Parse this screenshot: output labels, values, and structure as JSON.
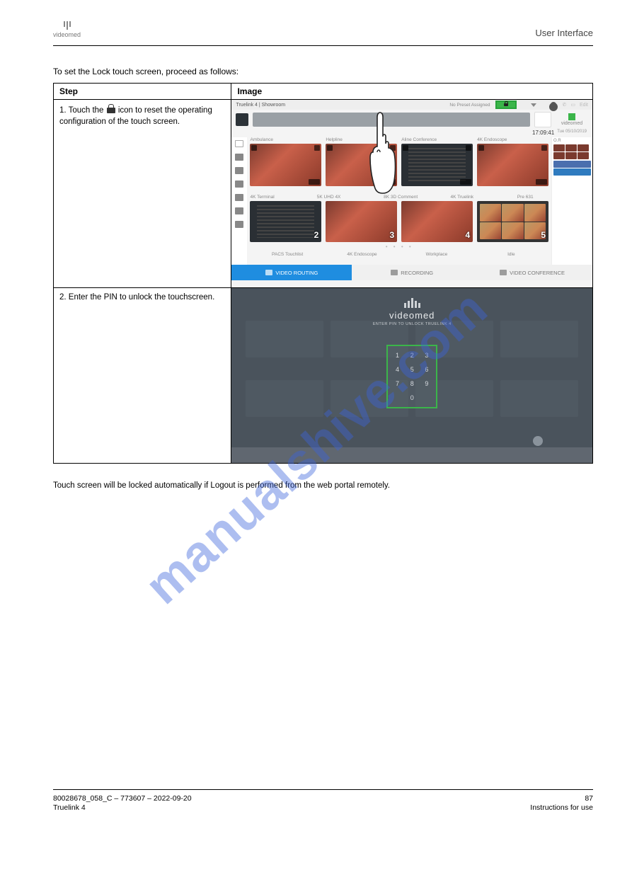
{
  "header": {
    "brand": "videomed",
    "section_title": "User Interface"
  },
  "intro": "To set the Lock touch screen, proceed as follows:",
  "table": {
    "col1": "Step",
    "col2": "Image",
    "step1_a": "1.  Touch the ",
    "step1_b": " icon to reset the operating configuration of the touch screen.",
    "step2": "2.  Enter the PIN to unlock the touchscreen."
  },
  "hint": "Touch screen will be locked automatically if Logout is performed from the web portal remotely.",
  "shot1": {
    "topbar": {
      "title": "Truelink 4 | Showroom",
      "no_preset": "No Preset Assigned",
      "right_text": "Edit"
    },
    "brand": "videomed",
    "time": "17:09:41",
    "date": "Tue 05/10/2019",
    "row1_labels": [
      "Ambulance",
      "Helpline",
      "Aline Conference",
      "4K Endoscope"
    ],
    "row2_labels": [
      "4K Terminal",
      "5K UHD 4X",
      "8K 3D Comment",
      "4K Truelink",
      "Pre 631"
    ],
    "row2_nums": [
      "2",
      "3",
      "4",
      "5"
    ],
    "sidepanel_hdr": "O.R",
    "dots": "• • • •",
    "presets": [
      "PACS Touchlist",
      "4K Endoscope",
      "Workplace",
      "Idle"
    ],
    "tabs": {
      "routing": "VIDEO ROUTING",
      "recording": "RECORDING",
      "conference": "VIDEO CONFERENCE"
    }
  },
  "shot2": {
    "brand": "videomed",
    "subtitle": "ENTER PIN TO UNLOCK TRUELINK 4",
    "keys": [
      [
        "1",
        "2",
        "3"
      ],
      [
        "4",
        "5",
        "6"
      ],
      [
        "7",
        "8",
        "9"
      ],
      [
        "",
        "0",
        ""
      ]
    ]
  },
  "footer": {
    "doc_ref": "80028678_058_C – 773607 – 2022-09-20",
    "page": "87",
    "product": "Truelink 4",
    "manual": "Instructions for use"
  }
}
